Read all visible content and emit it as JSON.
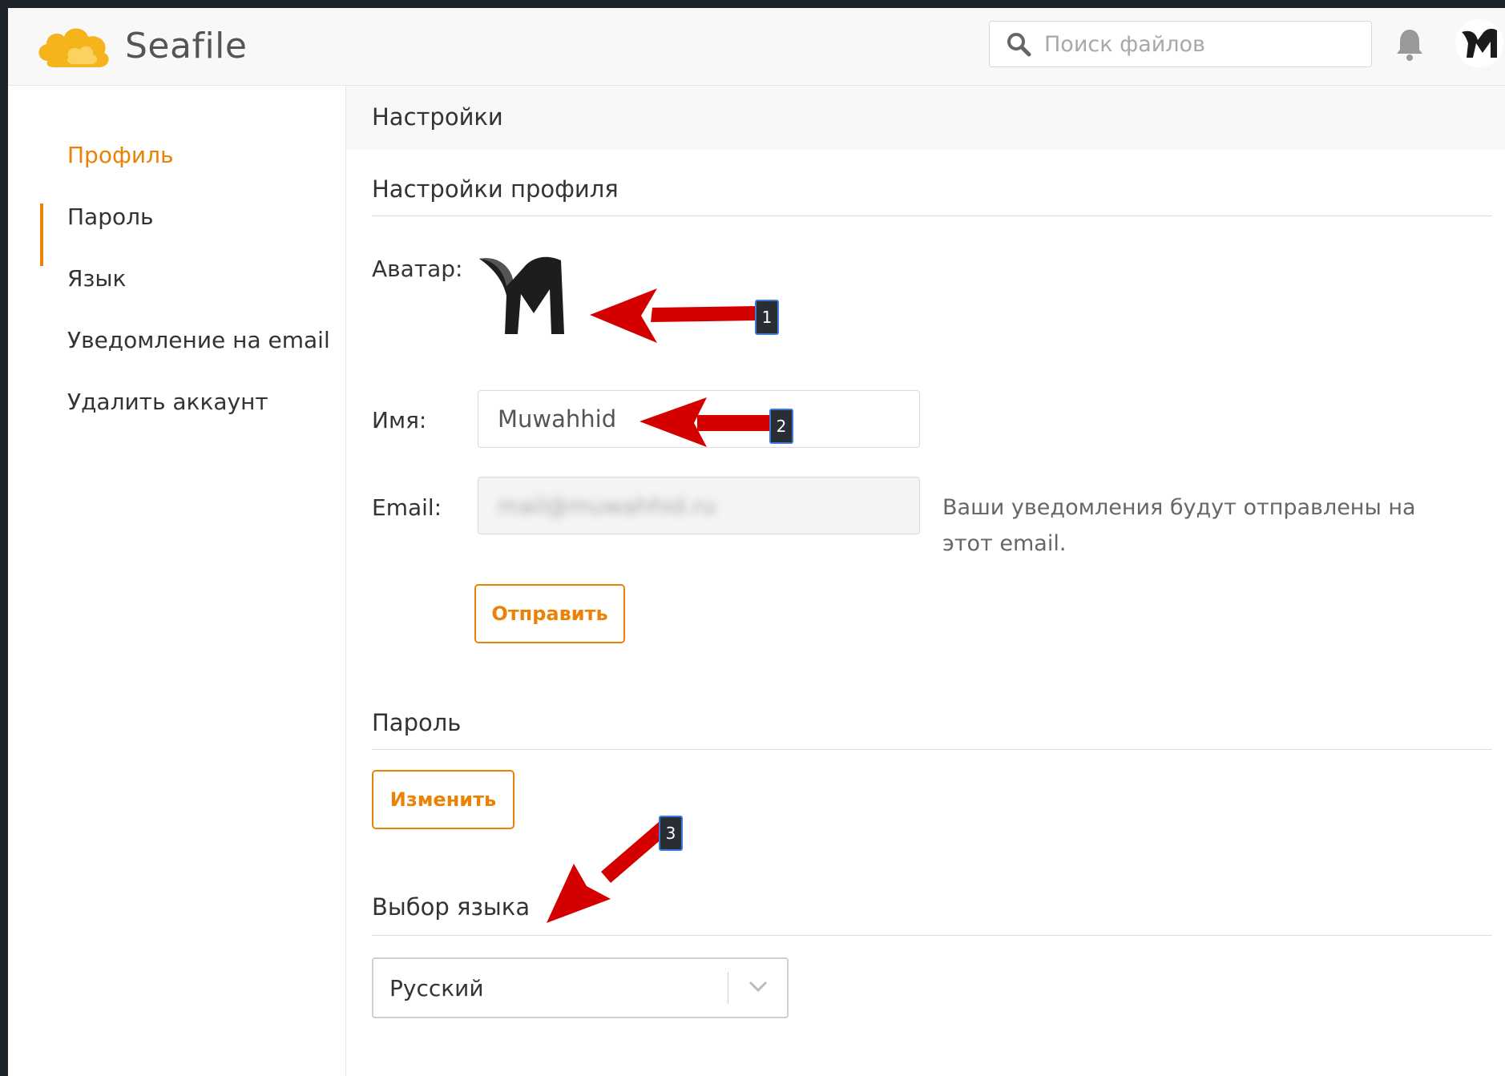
{
  "app": {
    "name": "Seafile"
  },
  "header": {
    "search_placeholder": "Поиск файлов"
  },
  "sidebar": {
    "items": [
      {
        "label": "Профиль",
        "active": true
      },
      {
        "label": "Пароль",
        "active": false
      },
      {
        "label": "Язык",
        "active": false
      },
      {
        "label": "Уведомление на email",
        "active": false
      },
      {
        "label": "Удалить аккаунт",
        "active": false
      }
    ]
  },
  "main": {
    "page_title": "Настройки",
    "profile": {
      "section_title": "Настройки профиля",
      "avatar_label": "Аватар:",
      "name_label": "Имя:",
      "name_value": "Muwahhid",
      "email_label": "Email:",
      "email_value": "mail@muwahhid.ru",
      "email_help": "Ваши уведомления будут отправлены на этот email.",
      "submit_label": "Отправить"
    },
    "password": {
      "section_title": "Пароль",
      "change_label": "Изменить"
    },
    "language": {
      "section_title": "Выбор языка",
      "selected": "Русский"
    }
  },
  "annotations": {
    "badges": [
      "1",
      "2",
      "3"
    ],
    "arrow_color": "#d40000"
  },
  "colors": {
    "accent": "#eb8205",
    "logo": "#f5b31c"
  }
}
